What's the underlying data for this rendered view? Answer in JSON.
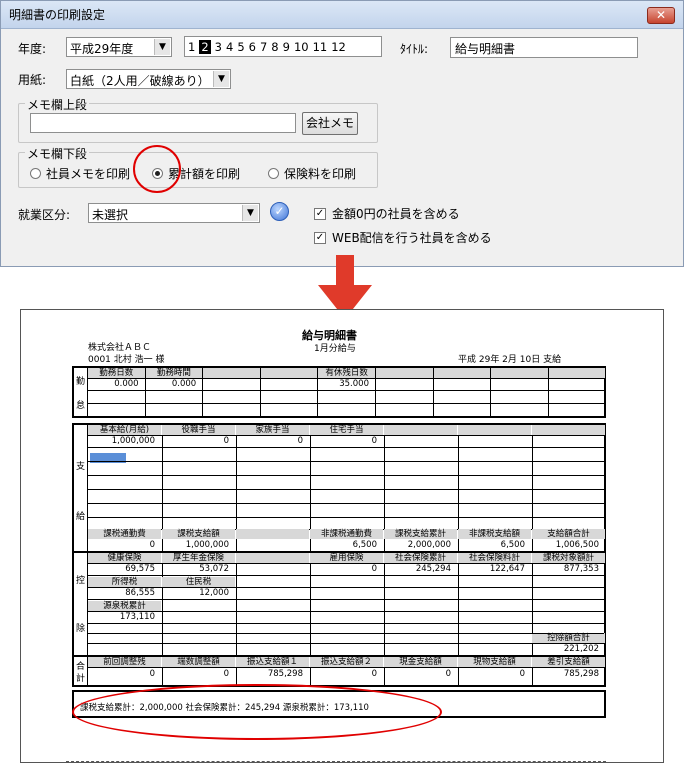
{
  "dialog": {
    "title": "明細書の印刷設定",
    "close_label": "✕",
    "year_label": "年度:",
    "year_value": "平成29年度",
    "months": [
      "1",
      "2",
      "3",
      "4",
      "5",
      "6",
      "7",
      "8",
      "9",
      "10",
      "11",
      "12"
    ],
    "selected_month": "2",
    "title_label": "ﾀｲﾄﾙ:",
    "title_value": "給与明細書",
    "paper_label": "用紙:",
    "paper_value": "白紙（2人用／破線あり）",
    "memo_upper_label": "メモ欄上段",
    "memo_upper_value": "",
    "company_memo_button": "会社メモ",
    "memo_lower_label": "メモ欄下段",
    "radio_options": [
      "社員メモを印刷",
      "累計額を印刷",
      "保険料を印刷"
    ],
    "radio_selected": "累計額を印刷",
    "employment_label": "就業区分:",
    "employment_value": "未選択",
    "checkbox1_label": "金額0円の社員を含める",
    "checkbox2_label": "WEB配信を行う社員を含める",
    "checkbox1_checked": true,
    "checkbox2_checked": true
  },
  "slip": {
    "title": "給与明細書",
    "period": "1月分給与",
    "company": "株式会社ＡＢＣ",
    "employee": "0001  北村   浩一   様",
    "date": "平成 29年  2月  10日  支給",
    "attendance_side": [
      "勤",
      "怠"
    ],
    "attendance_headers": [
      "勤務日数",
      "勤務時間",
      "",
      "",
      "有休残日数",
      "",
      "",
      "",
      ""
    ],
    "attendance_values": [
      "0.000",
      "0.000",
      "",
      "",
      "35.000",
      "",
      "",
      "",
      ""
    ],
    "pay_side": [
      "支",
      "給"
    ],
    "pay_headers": [
      "基本給(月給)",
      "役職手当",
      "家族手当",
      "住宅手当",
      "",
      "",
      "",
      ""
    ],
    "pay_values": [
      "1,000,000",
      "0",
      "0",
      "0",
      "",
      "",
      "",
      ""
    ],
    "pay_total_headers": [
      "課税通勤費",
      "課税支給額",
      "",
      "非課税通勤費",
      "課税支給累計",
      "非課税支給額",
      "支給額合計"
    ],
    "pay_total_values": [
      "0",
      "1,000,000",
      "",
      "6,500",
      "2,000,000",
      "6,500",
      "1,006,500"
    ],
    "deduct_side": [
      "控",
      "除"
    ],
    "deduct_headers1": [
      "健康保険",
      "厚生年金保険",
      "",
      "雇用保険",
      "社会保険累計",
      "社会保険料計",
      "課税対象額計"
    ],
    "deduct_values1": [
      "69,575",
      "53,072",
      "",
      "0",
      "245,294",
      "122,647",
      "877,353"
    ],
    "deduct_headers2": [
      "所得税",
      "住民税"
    ],
    "deduct_values2": [
      "86,555",
      "12,000"
    ],
    "deduct_headers3": [
      "源泉税累計"
    ],
    "deduct_values3": [
      "173,110"
    ],
    "deduct_total_header": "控除額合計",
    "deduct_total_value": "221,202",
    "total_side": [
      "合",
      "計"
    ],
    "total_headers": [
      "前回調整残",
      "端数調整額",
      "振込支給額１",
      "振込支給額２",
      "現金支給額",
      "現物支給額",
      "差引支給額"
    ],
    "total_values": [
      "0",
      "0",
      "785,298",
      "0",
      "0",
      "0",
      "785,298"
    ],
    "summary": "課税支給累計：2,000,000  社会保険累計：245,294  源泉税累計：173,110"
  },
  "colors": {
    "highlight_circle": "#e00000",
    "arrow": "#e03a2a"
  }
}
